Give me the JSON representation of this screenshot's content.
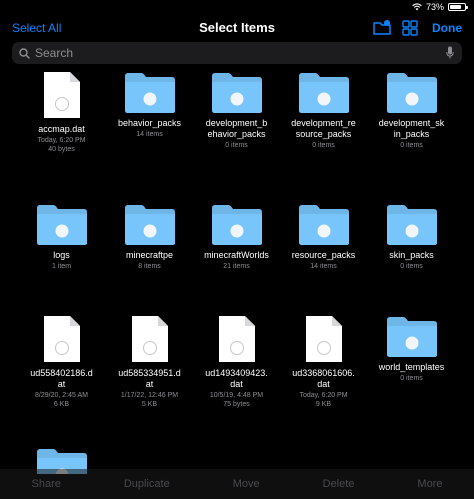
{
  "status": {
    "battery": "73%"
  },
  "header": {
    "select_all": "Select All",
    "title": "Select Items",
    "done": "Done"
  },
  "search": {
    "placeholder": "Search"
  },
  "items": [
    {
      "kind": "file",
      "name": "accmap.dat",
      "meta": "Today, 6:20 PM\n40 bytes"
    },
    {
      "kind": "folder",
      "name": "behavior_packs",
      "meta": "14 items"
    },
    {
      "kind": "folder",
      "name": "development_b\nehavior_packs",
      "meta": "0 items"
    },
    {
      "kind": "folder",
      "name": "development_re\nsource_packs",
      "meta": "0 items"
    },
    {
      "kind": "folder",
      "name": "development_sk\nin_packs",
      "meta": "0 items"
    },
    {
      "kind": "folder",
      "name": "logs",
      "meta": "1 item"
    },
    {
      "kind": "folder",
      "name": "minecraftpe",
      "meta": "8 items"
    },
    {
      "kind": "folder",
      "name": "minecraftWorlds",
      "meta": "21 items"
    },
    {
      "kind": "folder",
      "name": "resource_packs",
      "meta": "14 items"
    },
    {
      "kind": "folder",
      "name": "skin_packs",
      "meta": "0 items"
    },
    {
      "kind": "file",
      "name": "ud558402186.d\nat",
      "meta": "8/29/20, 2:45 AM\n6 KB"
    },
    {
      "kind": "file",
      "name": "ud585334951.d\nat",
      "meta": "1/17/22, 12:46 PM\n5 KB"
    },
    {
      "kind": "file",
      "name": "ud1493409423.\ndat",
      "meta": "10/5/19, 4:48 PM\n75 bytes"
    },
    {
      "kind": "file",
      "name": "ud3368061606.\ndat",
      "meta": "Today, 6:20 PM\n9 KB"
    },
    {
      "kind": "folder",
      "name": "world_templates",
      "meta": "0 items"
    },
    {
      "kind": "folder",
      "name": "",
      "meta": ""
    }
  ],
  "toolbar": {
    "share": "Share",
    "duplicate": "Duplicate",
    "move": "Move",
    "delete": "Delete",
    "more": "More"
  },
  "colors": {
    "accent": "#0a84ff",
    "folder": "#6eb6e8",
    "file": "#ffffff"
  }
}
